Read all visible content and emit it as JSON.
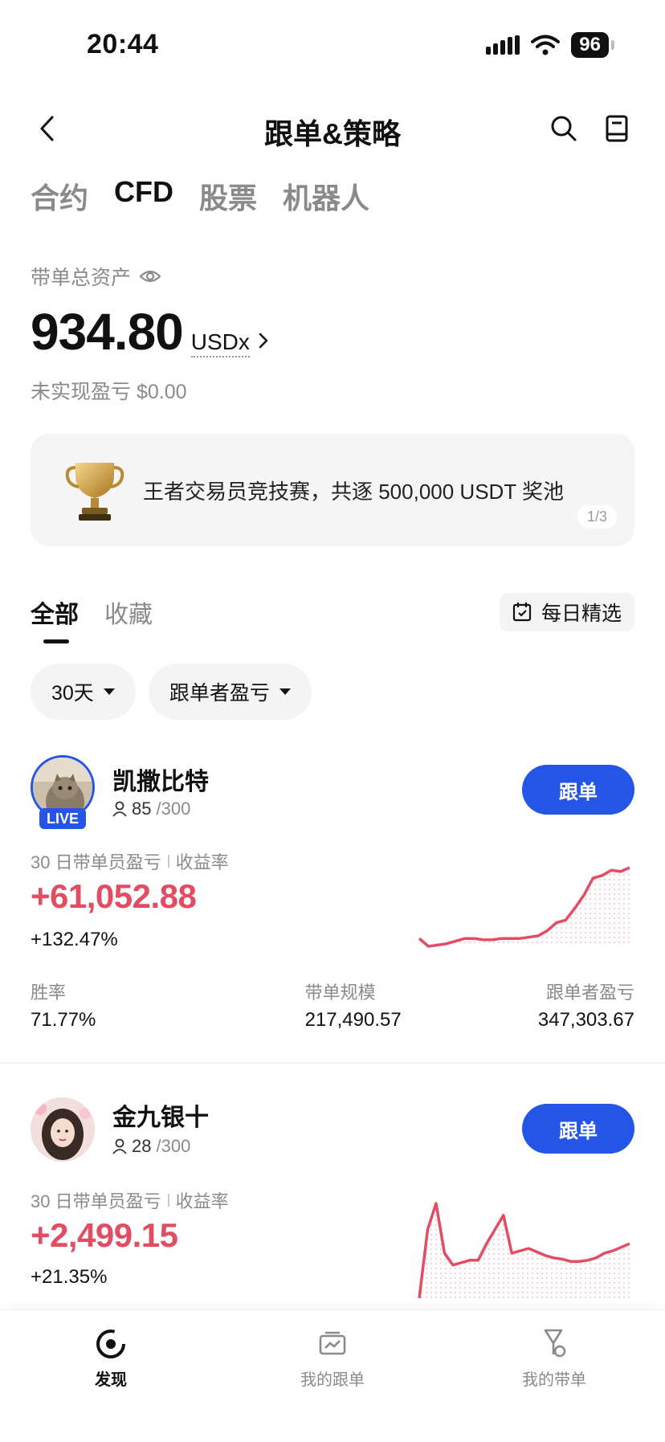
{
  "status": {
    "time": "20:44",
    "battery": "96"
  },
  "nav": {
    "title": "跟单&策略"
  },
  "categories": [
    {
      "label": "合约",
      "active": false
    },
    {
      "label": "CFD",
      "active": true
    },
    {
      "label": "股票",
      "active": false
    },
    {
      "label": "机器人",
      "active": false
    }
  ],
  "assets": {
    "label": "带单总资产",
    "value": "934.80",
    "unit": "USDx",
    "unrealized": "未实现盈亏 $0.00"
  },
  "banner": {
    "text": "王者交易员竞技赛，共逐 500,000 USDT 奖池",
    "pager": "1/3"
  },
  "list_tabs": {
    "all": "全部",
    "favorites": "收藏",
    "daily_pick": "每日精选"
  },
  "filters": {
    "period": "30天",
    "sort": "跟单者盈亏"
  },
  "traders": [
    {
      "name": "凯撒比特",
      "live": "LIVE",
      "followers": "85",
      "capacity": "/300",
      "follow_label": "跟单",
      "pnl_label": "30 日带单员盈亏",
      "roi_label": "收益率",
      "pnl": "+61,052.88",
      "roi": "+132.47%",
      "stats": [
        {
          "label": "胜率",
          "value": "71.77%"
        },
        {
          "label": "带单规模",
          "value": "217,490.57"
        },
        {
          "label": "跟单者盈亏",
          "value": "347,303.67"
        }
      ],
      "trend": [
        12,
        6,
        7,
        8,
        10,
        12,
        12,
        11,
        11,
        12,
        12,
        12,
        13,
        14,
        18,
        24,
        26,
        35,
        45,
        58,
        60,
        64,
        63,
        66
      ]
    },
    {
      "name": "金九银十",
      "followers": "28",
      "capacity": "/300",
      "follow_label": "跟单",
      "pnl_label": "30 日带单员盈亏",
      "roi_label": "收益率",
      "pnl": "+2,499.15",
      "roi": "+21.35%",
      "trend": [
        2,
        60,
        82,
        40,
        30,
        32,
        34,
        34,
        48,
        60,
        72,
        40,
        42,
        44,
        41,
        38,
        36,
        35,
        33,
        33,
        34,
        36,
        40,
        42,
        45,
        48
      ]
    }
  ],
  "bottom_nav": [
    {
      "label": "发现",
      "icon": "discover-icon",
      "active": true
    },
    {
      "label": "我的跟单",
      "icon": "my-copy-icon",
      "active": false
    },
    {
      "label": "我的带单",
      "icon": "my-lead-icon",
      "active": false
    }
  ],
  "colors": {
    "accent": "#2455e6",
    "profit": "#e24d63"
  }
}
